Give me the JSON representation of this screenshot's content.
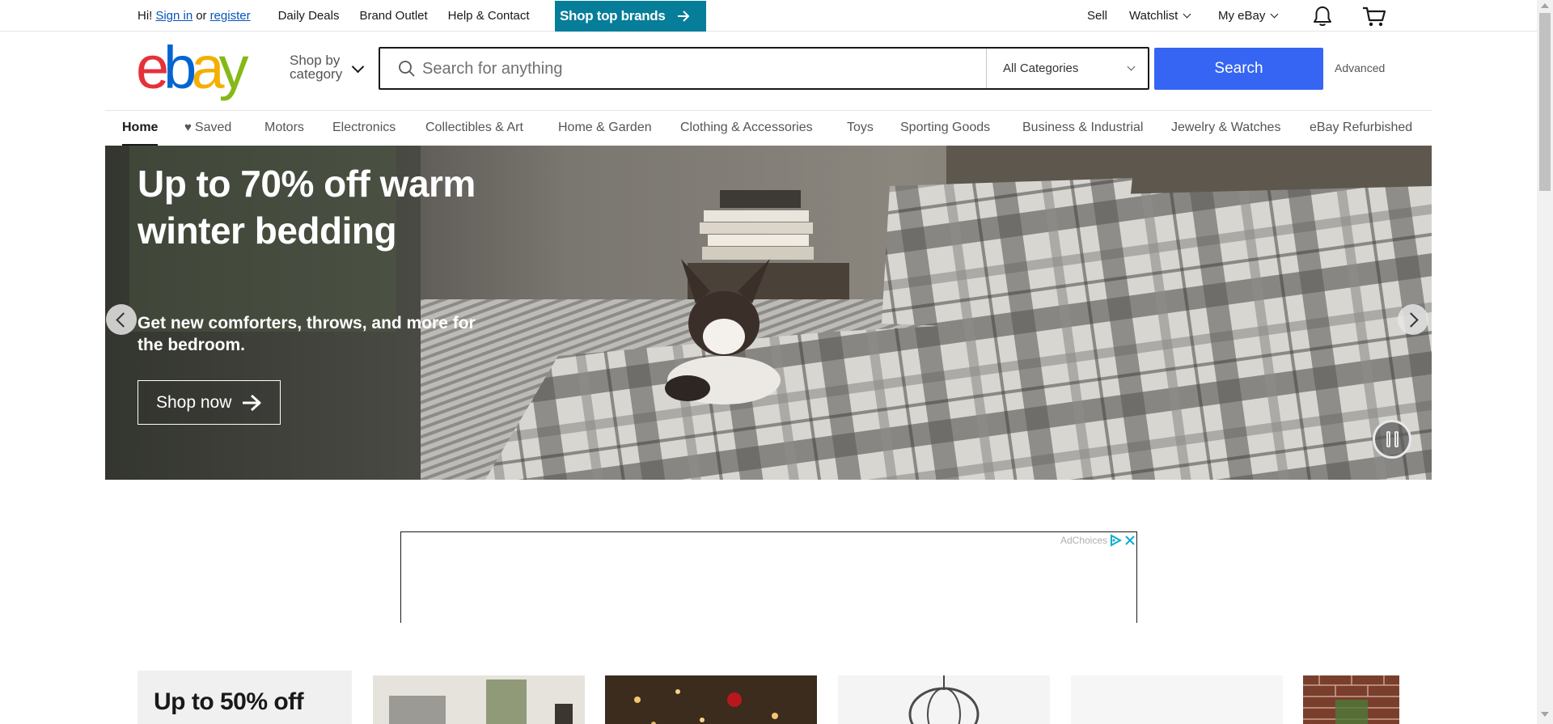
{
  "topbar": {
    "greeting": "Hi!",
    "sign_in": "Sign in",
    "or": "or",
    "register": "register",
    "links": [
      "Daily Deals",
      "Brand Outlet",
      "Help & Contact"
    ],
    "promo_label": "Shop top brands",
    "sell": "Sell",
    "watchlist": "Watchlist",
    "my_ebay": "My eBay"
  },
  "header": {
    "logo": {
      "e": "e",
      "b": "b",
      "a": "a",
      "y": "y"
    },
    "shop_by_category_1": "Shop by",
    "shop_by_category_2": "category",
    "search_placeholder": "Search for anything",
    "category_selected": "All Categories",
    "search_button": "Search",
    "advanced": "Advanced"
  },
  "nav": {
    "items": [
      "Home",
      "Saved",
      "Motors",
      "Electronics",
      "Collectibles & Art",
      "Home & Garden",
      "Clothing & Accessories",
      "Toys",
      "Sporting Goods",
      "Business & Industrial",
      "Jewelry & Watches",
      "eBay Refurbished"
    ],
    "active": "Home"
  },
  "hero": {
    "title": "Up to 70% off warm winter bedding",
    "subtitle": "Get new comforters, throws, and more for the bedroom.",
    "cta": "Shop now"
  },
  "ad": {
    "adchoices": "AdChoices"
  },
  "promo": {
    "title": "Up to 50% off"
  },
  "colors": {
    "brand_blue": "#3665f3",
    "promo_teal": "#067d99",
    "logo_red": "#e53238",
    "logo_blue": "#0064d2",
    "logo_yellow": "#f5af02",
    "logo_green": "#86b817"
  }
}
